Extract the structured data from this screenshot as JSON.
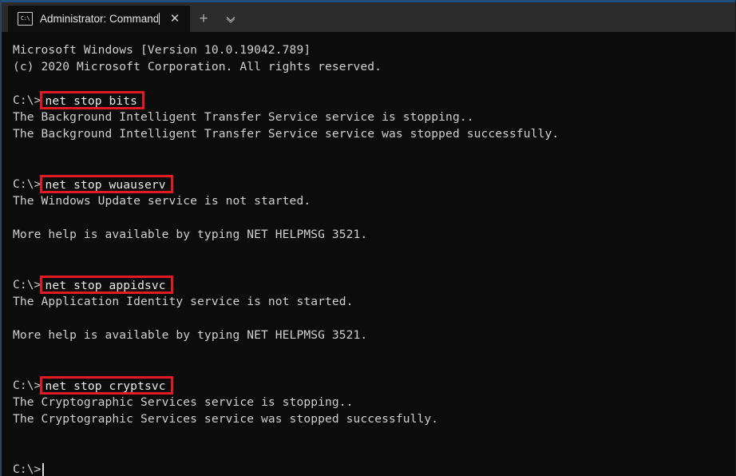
{
  "window": {
    "accent_color": "#1f4f7a",
    "background_color": "#0c0c0c",
    "tabbar_color": "#2b2b2b"
  },
  "tabbar": {
    "tab_icon_label": "C:\\",
    "tab_title": "Administrator: Command Prom",
    "close_label": "✕",
    "new_tab_label": "+",
    "dropdown_label": "⌄"
  },
  "terminal": {
    "highlight_color": "#e01b24",
    "text_color": "#cfcfcf",
    "prompt": "C:\\>",
    "lines": [
      {
        "type": "text",
        "text": "Microsoft Windows [Version 10.0.19042.789]"
      },
      {
        "type": "text",
        "text": "(c) 2020 Microsoft Corporation. All rights reserved."
      },
      {
        "type": "blank",
        "text": ""
      },
      {
        "type": "command",
        "prompt": "C:\\>",
        "command": "net stop bits"
      },
      {
        "type": "text",
        "text": "The Background Intelligent Transfer Service service is stopping.."
      },
      {
        "type": "text",
        "text": "The Background Intelligent Transfer Service service was stopped successfully."
      },
      {
        "type": "blank",
        "text": ""
      },
      {
        "type": "blank",
        "text": ""
      },
      {
        "type": "command",
        "prompt": "C:\\>",
        "command": "net stop wuauserv"
      },
      {
        "type": "text",
        "text": "The Windows Update service is not started."
      },
      {
        "type": "blank",
        "text": ""
      },
      {
        "type": "text",
        "text": "More help is available by typing NET HELPMSG 3521."
      },
      {
        "type": "blank",
        "text": ""
      },
      {
        "type": "blank",
        "text": ""
      },
      {
        "type": "command",
        "prompt": "C:\\>",
        "command": "net stop appidsvc"
      },
      {
        "type": "text",
        "text": "The Application Identity service is not started."
      },
      {
        "type": "blank",
        "text": ""
      },
      {
        "type": "text",
        "text": "More help is available by typing NET HELPMSG 3521."
      },
      {
        "type": "blank",
        "text": ""
      },
      {
        "type": "blank",
        "text": ""
      },
      {
        "type": "command",
        "prompt": "C:\\>",
        "command": "net stop cryptsvc"
      },
      {
        "type": "text",
        "text": "The Cryptographic Services service is stopping.."
      },
      {
        "type": "text",
        "text": "The Cryptographic Services service was stopped successfully."
      },
      {
        "type": "blank",
        "text": ""
      },
      {
        "type": "blank",
        "text": ""
      },
      {
        "type": "cursor",
        "prompt": "C:\\>"
      }
    ]
  }
}
